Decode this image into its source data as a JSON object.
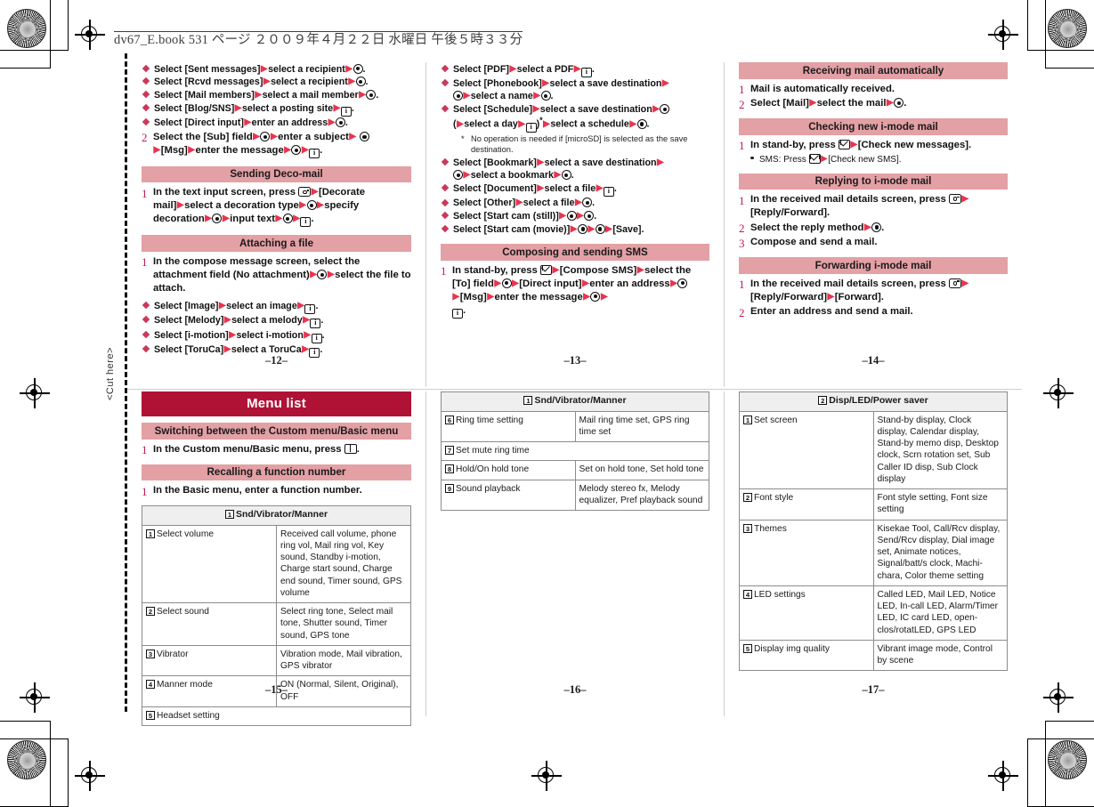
{
  "print_header": "dv67_E.book  531 ページ  ２００９年４月２２日  水曜日  午後５時３３分",
  "cut_marker": "<Cut here>",
  "colors": {
    "heading_main": "#b01236",
    "heading_sub": "#e3a0a5",
    "arrow": "#e8344e",
    "step_number": "#c2185b"
  },
  "pages": {
    "p12": {
      "number": "–12–"
    },
    "p13": {
      "number": "–13–"
    },
    "p14": {
      "number": "–14–"
    },
    "p15": {
      "number": "–15–"
    },
    "p16": {
      "number": "–16–"
    },
    "p17": {
      "number": "–17–"
    }
  },
  "col1_top": {
    "bullets_top": [
      {
        "a": "Select [Sent messages]",
        "b": "select a recipient",
        "end": "sel"
      },
      {
        "a": "Select [Rcvd messages]",
        "b": "select a recipient",
        "end": "sel"
      },
      {
        "a": "Select [Mail members]",
        "b": "select a mail member",
        "end": "sel"
      },
      {
        "a": "Select [Blog/SNS]",
        "b": "select a posting site",
        "end": "ibox"
      },
      {
        "a": "Select [Direct input]",
        "b": "enter an address",
        "end": "sel"
      }
    ],
    "step2": {
      "num": "2",
      "t1": "Select the [Sub] field",
      "t2": "enter a subject",
      "t3": "[Msg]",
      "t4": "enter the message"
    },
    "deco": {
      "heading": "Sending Deco-mail",
      "step_num": "1",
      "t1": "In the text input screen, press",
      "t2": "[Decorate mail]",
      "t3": "select a decoration type",
      "t4": "specify decoration",
      "t5": "input text"
    },
    "attach": {
      "heading": "Attaching a file",
      "step_num": "1",
      "t1": "In the compose message screen, select the attachment field (No attachment)",
      "t2": "select the file to attach.",
      "bullets": [
        {
          "a": "Select [Image]",
          "b": "select an image",
          "end": "ibox"
        },
        {
          "a": "Select [Melody]",
          "b": "select a melody",
          "end": "ibox"
        },
        {
          "a": "Select [i-motion]",
          "b": "select i-motion",
          "end": "ibox"
        },
        {
          "a": "Select [ToruCa]",
          "b": "select a ToruCa",
          "end": "ibox"
        }
      ]
    }
  },
  "col2_top": {
    "bullets": [
      {
        "line": "simple",
        "a": "Select [PDF]",
        "b": "select a PDF",
        "end": "ibox"
      },
      {
        "line": "phonebook",
        "a": "Select [Phonebook]",
        "b": "select a save destination",
        "c": "select a name"
      },
      {
        "line": "schedule",
        "a": "Select [Schedule]",
        "b": "select a save destination",
        "c": "select a day",
        "d": "select a schedule"
      },
      {
        "line": "note",
        "text": "No operation is needed if [microSD] is selected as the save destination."
      },
      {
        "line": "bookmark",
        "a": "Select [Bookmark]",
        "b": "select a save destination",
        "c": "select a bookmark"
      },
      {
        "line": "simple",
        "a": "Select [Document]",
        "b": "select a file",
        "end": "ibox"
      },
      {
        "line": "simple",
        "a": "Select [Other]",
        "b": "select a file",
        "end": "sel"
      },
      {
        "line": "cam_still",
        "a": "Select [Start cam (still)]"
      },
      {
        "line": "cam_movie",
        "a": "Select [Start cam (movie)]",
        "save": "[Save]."
      }
    ],
    "sms": {
      "heading": "Composing and sending SMS",
      "step_num": "1",
      "t1": "In stand-by, press",
      "t2": "[Compose SMS]",
      "t3": "select the [To] field",
      "t4": "[Direct input]",
      "t5": "enter an address",
      "t6": "[Msg]",
      "t7": "enter the message"
    }
  },
  "col3_top": {
    "sections": [
      {
        "heading": "Receiving mail automatically",
        "steps": [
          {
            "num": "1",
            "kind": "plain",
            "t1": "Mail is automatically received."
          },
          {
            "num": "2",
            "kind": "mail_select",
            "t1": "Select [Mail]",
            "t2": "select the mail"
          }
        ]
      },
      {
        "heading": "Checking new i-mode mail",
        "steps": [
          {
            "num": "1",
            "kind": "standby_check",
            "t1": "In stand-by, press",
            "t2": "[Check new messages]."
          }
        ],
        "subbullet": {
          "t1": "SMS: Press",
          "t2": "[Check new SMS]."
        }
      },
      {
        "heading": "Replying to i-mode mail",
        "steps": [
          {
            "num": "1",
            "kind": "cam_reply",
            "t1": "In the received mail details screen, press",
            "t2": "[Reply/Forward]."
          },
          {
            "num": "2",
            "kind": "reply_method",
            "t1": "Select the reply method"
          },
          {
            "num": "3",
            "kind": "plain",
            "t1": "Compose and send a mail."
          }
        ]
      },
      {
        "heading": "Forwarding i-mode mail",
        "steps": [
          {
            "num": "1",
            "kind": "cam_forward",
            "t1": "In the received mail details screen, press",
            "t2": "[Reply/Forward]",
            "t3": "[Forward]."
          },
          {
            "num": "2",
            "kind": "plain",
            "t1": "Enter an address and send a mail."
          }
        ]
      }
    ]
  },
  "col1_bot": {
    "main_heading": "Menu list",
    "sections": [
      {
        "heading": "Switching between the Custom menu/Basic menu",
        "step_num": "1",
        "text": "In the Custom menu/Basic menu, press",
        "icon": "menu-key"
      },
      {
        "heading": "Recalling a function number",
        "step_num": "1",
        "text": "In the Basic menu, enter a function number.",
        "icon": ""
      }
    ],
    "table": {
      "title_index": "1",
      "title": "Snd/Vibrator/Manner",
      "rows": [
        {
          "idx": "1",
          "name": "Select volume",
          "value": "Received call volume, phone ring vol, Mail ring vol, Key sound, Standby i-motion, Charge start sound, Charge end sound, Timer sound, GPS volume"
        },
        {
          "idx": "2",
          "name": "Select sound",
          "value": "Select ring tone, Select mail tone, Shutter sound, Timer sound, GPS tone"
        },
        {
          "idx": "3",
          "name": "Vibrator",
          "value": "Vibration mode, Mail vibration, GPS vibrator"
        },
        {
          "idx": "4",
          "name": "Manner mode",
          "value": "ON (Normal, Silent, Original), OFF"
        },
        {
          "idx": "5",
          "name": "Headset setting",
          "value": "",
          "span": true
        }
      ]
    }
  },
  "col2_bot": {
    "table": {
      "title_index": "1",
      "title": "Snd/Vibrator/Manner",
      "rows": [
        {
          "idx": "6",
          "name": "Ring time setting",
          "value": "Mail ring time set, GPS ring time set"
        },
        {
          "idx": "7",
          "name": "Set mute ring time",
          "value": "",
          "span": true
        },
        {
          "idx": "8",
          "name": "Hold/On hold tone",
          "value": "Set on hold tone, Set hold tone"
        },
        {
          "idx": "9",
          "name": "Sound playback",
          "value": "Melody stereo fx, Melody equalizer, Pref playback sound"
        }
      ]
    }
  },
  "col3_bot": {
    "table": {
      "title_index": "2",
      "title": "Disp/LED/Power saver",
      "rows": [
        {
          "idx": "1",
          "name": "Set screen",
          "value": "Stand-by display, Clock display, Calendar display, Stand-by memo disp, Desktop clock, Scrn rotation set, Sub Caller ID disp, Sub Clock display"
        },
        {
          "idx": "2",
          "name": "Font style",
          "value": "Font style setting, Font size setting"
        },
        {
          "idx": "3",
          "name": "Themes",
          "value": "Kisekae Tool, Call/Rcv display, Send/Rcv display, Dial image set, Animate notices, Signal/batt/s clock, Machi-chara, Color theme setting"
        },
        {
          "idx": "4",
          "name": "LED settings",
          "value": "Called LED, Mail LED, Notice LED, In-call LED, Alarm/Timer LED, IC card LED, open-clos/rotatLED, GPS LED"
        },
        {
          "idx": "5",
          "name": "Display img quality",
          "value": "Vibrant image mode, Control by scene"
        }
      ]
    }
  }
}
